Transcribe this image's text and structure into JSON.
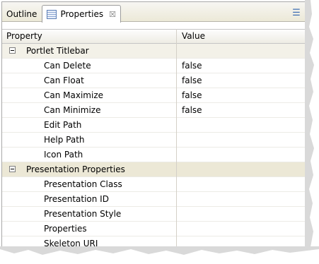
{
  "tabs": [
    {
      "label": "Outline"
    },
    {
      "label": "Properties",
      "close": "☒"
    }
  ],
  "table": {
    "headers": {
      "property": "Property",
      "value": "Value"
    },
    "rows": [
      {
        "type": "category",
        "label": "Portlet Titlebar"
      },
      {
        "type": "prop",
        "label": "Can Delete",
        "value": "false"
      },
      {
        "type": "prop",
        "label": "Can Float",
        "value": "false"
      },
      {
        "type": "prop",
        "label": "Can Maximize",
        "value": "false"
      },
      {
        "type": "prop",
        "label": "Can Minimize",
        "value": "false"
      },
      {
        "type": "prop",
        "label": "Edit Path",
        "value": ""
      },
      {
        "type": "prop",
        "label": "Help Path",
        "value": ""
      },
      {
        "type": "prop",
        "label": "Icon Path",
        "value": ""
      },
      {
        "type": "category",
        "label": "Presentation Properties"
      },
      {
        "type": "prop",
        "label": "Presentation Class",
        "value": ""
      },
      {
        "type": "prop",
        "label": "Presentation ID",
        "value": ""
      },
      {
        "type": "prop",
        "label": "Presentation Style",
        "value": ""
      },
      {
        "type": "prop",
        "label": "Properties",
        "value": ""
      },
      {
        "type": "prop",
        "label": "Skeleton URI",
        "value": ""
      }
    ]
  },
  "icons": {
    "properties_tab": "table-icon",
    "view_menu": "tree-menu-icon"
  }
}
